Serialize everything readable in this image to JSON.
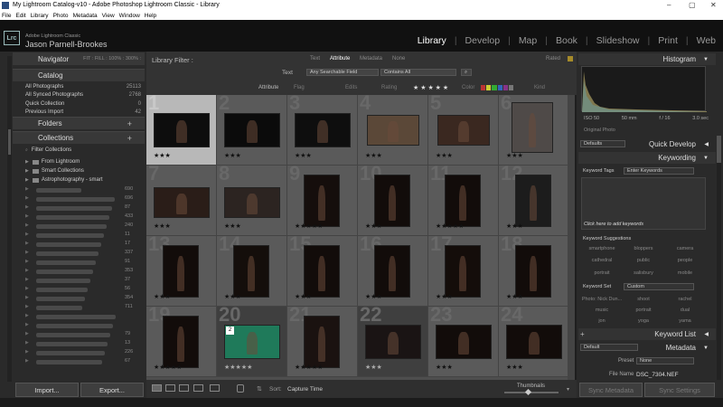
{
  "window": {
    "title": "My Lightroom Catalog-v10 - Adobe Photoshop Lightroom Classic - Library",
    "controls": [
      "–",
      "▢",
      "✕"
    ]
  },
  "menu": [
    "File",
    "Edit",
    "Library",
    "Photo",
    "Metadata",
    "View",
    "Window",
    "Help"
  ],
  "identity": {
    "app": "Adobe Lightroom Classic",
    "user": "Jason Parnell-Brookes",
    "logo": "Lrc"
  },
  "modules": [
    {
      "label": "Library",
      "active": true
    },
    {
      "label": "Develop"
    },
    {
      "label": "Map"
    },
    {
      "label": "Book"
    },
    {
      "label": "Slideshow"
    },
    {
      "label": "Print"
    },
    {
      "label": "Web"
    }
  ],
  "navigator": {
    "title": "Navigator",
    "zoom_options": "FIT : FILL : 100% : 300% :"
  },
  "catalog": {
    "title": "Catalog",
    "items": [
      {
        "label": "All Photographs",
        "count": "25113"
      },
      {
        "label": "All Synced Photographs",
        "count": "2768"
      },
      {
        "label": "Quick Collection",
        "count": "0"
      },
      {
        "label": "Previous Import",
        "count": "42"
      }
    ]
  },
  "folders": {
    "title": "Folders",
    "add": "+"
  },
  "collections": {
    "title": "Collections",
    "add": "+",
    "filter_label": "Filter Collections",
    "items": [
      "From Lightroom",
      "Smart Collections",
      "Astrophotography - smart"
    ],
    "astro_count": "38",
    "hidden_counts": [
      "690",
      "696",
      "87",
      "433",
      "240",
      "11",
      "17",
      "337",
      "91",
      "353",
      "37",
      "56",
      "354",
      "711",
      "",
      "",
      "79",
      "13",
      "226",
      "67"
    ]
  },
  "left_buttons": {
    "import": "Import...",
    "export": "Export..."
  },
  "filter_bar": {
    "title": "Library Filter :",
    "tabs": [
      "Text",
      "Attribute",
      "Metadata",
      "None"
    ],
    "active_tab": "Attribute",
    "preset": "Rated",
    "text_label": "Text",
    "search_field": "Any Searchable Field",
    "search_rule": "Contains All",
    "attr_label": "Attribute",
    "flag_label": "Flag",
    "edits_label": "Edits",
    "rating_label": "Rating",
    "rating_stars": "★ ★ ★ ★ ★",
    "color_label": "Color",
    "kind_label": "Kind"
  },
  "grid": {
    "cells": [
      {
        "num": "1",
        "stars": "★★★",
        "sel": true
      },
      {
        "num": "2",
        "stars": "★★★"
      },
      {
        "num": "3",
        "stars": "★★★"
      },
      {
        "num": "4",
        "stars": "★★★"
      },
      {
        "num": "5",
        "stars": "★★★"
      },
      {
        "num": "6",
        "stars": "★★★"
      },
      {
        "num": "7",
        "stars": "★★★"
      },
      {
        "num": "8",
        "stars": "★★★"
      },
      {
        "num": "9",
        "stars": "★★★★★"
      },
      {
        "num": "10",
        "stars": "★★★"
      },
      {
        "num": "11",
        "stars": "★★★★★"
      },
      {
        "num": "12",
        "stars": "★★★"
      },
      {
        "num": "13",
        "stars": "★★★"
      },
      {
        "num": "14",
        "stars": "★★★"
      },
      {
        "num": "15",
        "stars": "★★★"
      },
      {
        "num": "16",
        "stars": "★★★"
      },
      {
        "num": "17",
        "stars": "★★★"
      },
      {
        "num": "18",
        "stars": "★★★"
      },
      {
        "num": "19",
        "stars": "★★★★★"
      },
      {
        "num": "20",
        "stars": "★★★★★",
        "dark": true
      },
      {
        "num": "21",
        "stars": "★★★★★"
      },
      {
        "num": "22",
        "stars": "★★★",
        "dark": true
      },
      {
        "num": "23",
        "stars": "★★★"
      },
      {
        "num": "24",
        "stars": "★★★"
      }
    ],
    "badge_20": "2"
  },
  "toolbar": {
    "sort_label": "Sort:",
    "sort_value": "Capture Time",
    "thumbnails_label": "Thumbnails"
  },
  "right": {
    "histogram": "Histogram",
    "exif": [
      "ISO 50",
      "50 mm",
      "f / 16",
      "3.0 sec"
    ],
    "original_photo": "Original Photo",
    "quick_develop": "Quick Develop",
    "qd_preset": "Defaults",
    "keywording": "Keywording",
    "keyword_tags_label": "Keyword Tags",
    "keyword_tags_value": "Enter Keywords",
    "click_to_add": "Click here to add keywords",
    "keyword_suggestions": "Keyword Suggestions",
    "suggestions": [
      "smartphone",
      "bloppers",
      "camera",
      "cathedral",
      "public",
      "people",
      "portrait",
      "salisbury",
      "mobile"
    ],
    "keyword_set_label": "Keyword Set",
    "keyword_set_value": "Custom",
    "keyword_set": [
      "Photo: Nick Dun...",
      "shoot",
      "rachel",
      "music",
      "portrait",
      "dual",
      "jon",
      "yoga",
      "yama"
    ],
    "keyword_list": "Keyword List",
    "metadata": "Metadata",
    "meta_default": "Default",
    "preset_label": "Preset",
    "preset_value": "None",
    "file_name_label": "File Name",
    "file_name_value": "DSC_7304.NEF",
    "sync_metadata": "Sync Metadata",
    "sync_settings": "Sync Settings"
  }
}
